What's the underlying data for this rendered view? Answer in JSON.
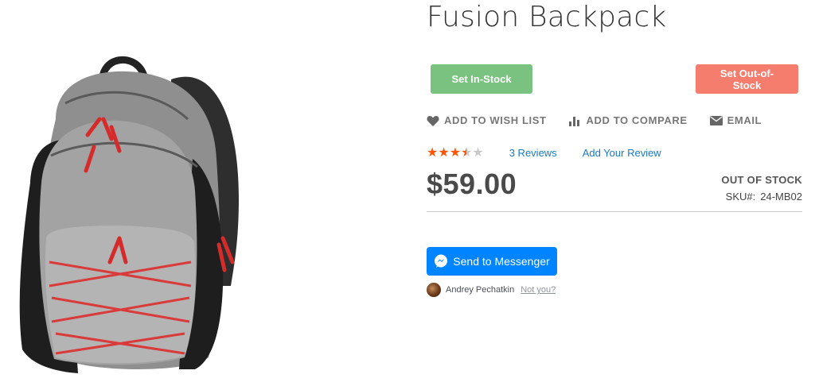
{
  "product": {
    "title": "Fusion Backpack",
    "price": "$59.00",
    "stock_status": "OUT OF STOCK",
    "sku_label": "SKU#:",
    "sku": "24-MB02",
    "rating_stars": 3.5,
    "rating_max": 5
  },
  "admin_buttons": {
    "in_stock": "Set In-Stock",
    "out_of_stock": "Set Out-of-Stock"
  },
  "actions": {
    "wishlist": "ADD TO WISH LIST",
    "compare": "ADD TO COMPARE",
    "email": "EMAIL"
  },
  "reviews": {
    "count_link": "3 Reviews",
    "add_link": "Add Your Review"
  },
  "messenger": {
    "button": "Send to Messenger",
    "user_name": "Andrey Pechatkin",
    "not_you": "Not you?"
  },
  "colors": {
    "in_stock_button": "#7ac27f",
    "out_of_stock_button": "#f47d6e",
    "star": "#ff5501",
    "link": "#1979c3",
    "messenger": "#0084ff"
  }
}
